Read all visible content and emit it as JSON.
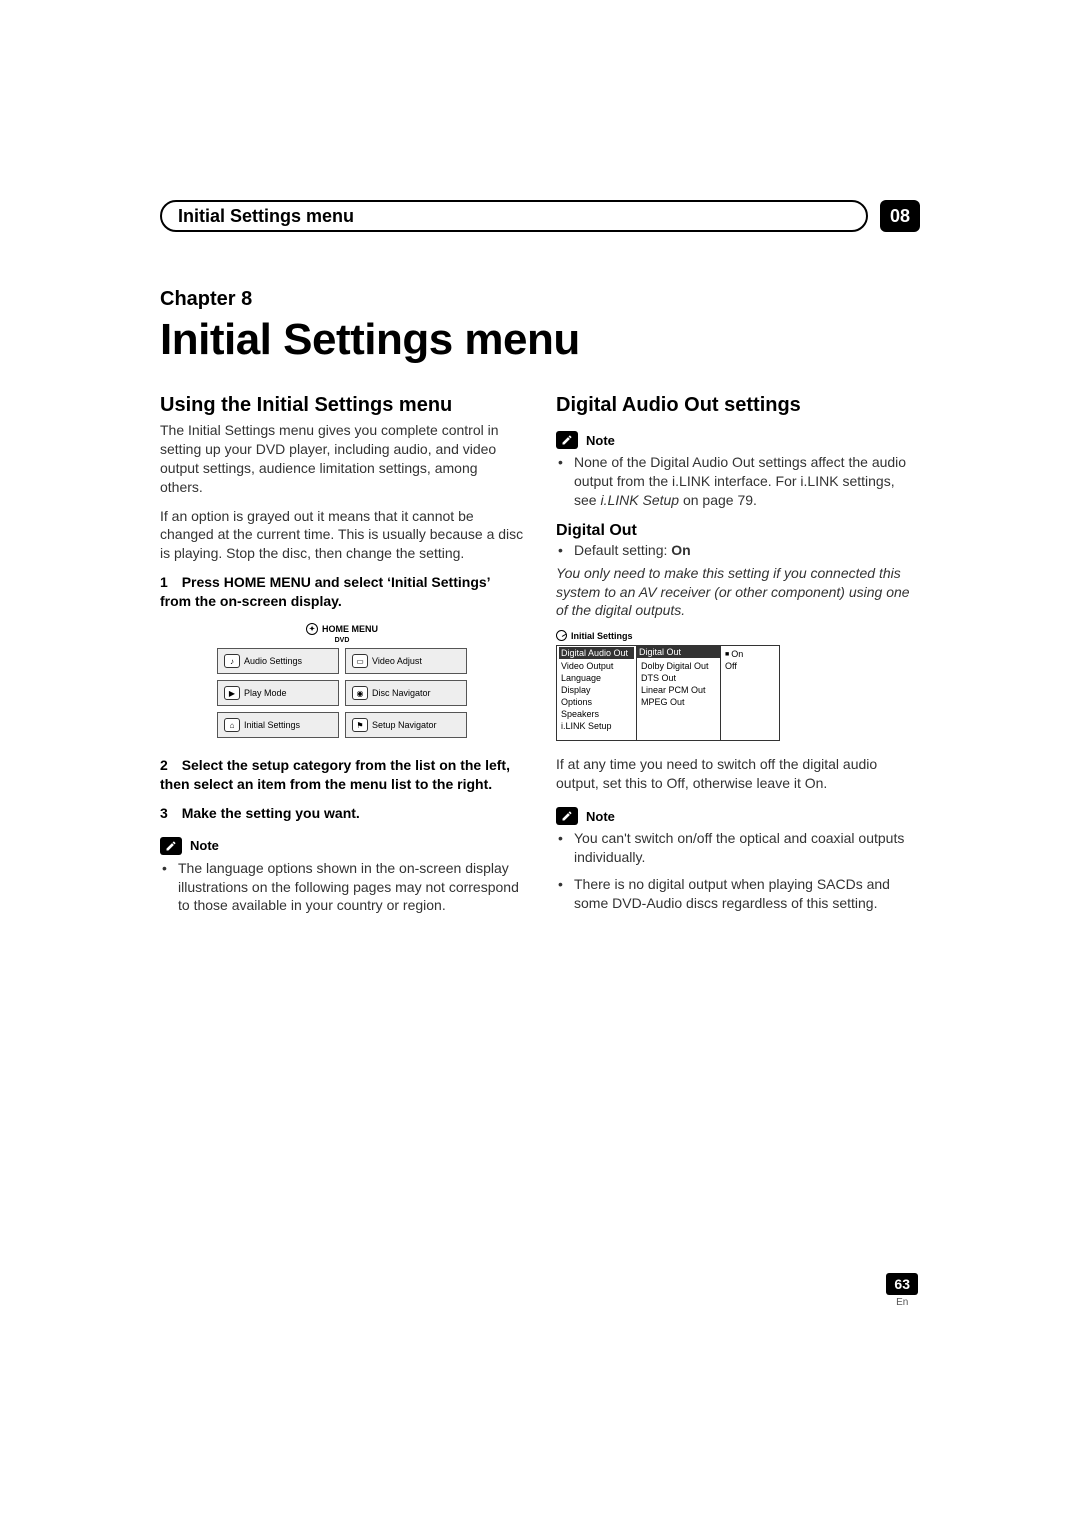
{
  "header": {
    "breadcrumb": "Initial Settings menu",
    "chapter_num": "08"
  },
  "chapter": {
    "label": "Chapter 8",
    "title": "Initial Settings menu"
  },
  "left": {
    "h2": "Using the Initial Settings menu",
    "p1": "The Initial Settings menu gives you complete control in setting up your DVD player, including audio, and video output settings, audience limitation settings, among others.",
    "p2": "If an option is grayed out it means that it cannot be changed at the current time. This is usually because a disc is playing. Stop the disc, then change the setting.",
    "step1_num": "1",
    "step1_txt": "Press HOME MENU and select ‘Initial Settings’ from the on-screen display.",
    "home_menu": {
      "title": "HOME MENU",
      "sub": "DVD",
      "cells": [
        "Audio Settings",
        "Video Adjust",
        "Play Mode",
        "Disc Navigator",
        "Initial Settings",
        "Setup Navigator"
      ]
    },
    "step2_num": "2",
    "step2_txt": "Select the setup category from the list on the left, then select an item from the menu list to the right.",
    "step3_num": "3",
    "step3_txt": "Make the setting you want.",
    "note_label": "Note",
    "note1": "The language options shown in the on-screen display illustrations on the following pages may not correspond to those available in your country or region."
  },
  "right": {
    "h2": "Digital Audio Out settings",
    "note_label": "Note",
    "note1_a": "None of the Digital Audio Out settings affect the audio output from the i.LINK interface. For i.LINK settings, see ",
    "note1_i": "i.LINK Setup",
    "note1_b": " on page 79.",
    "h3": "Digital Out",
    "default_label": "Default setting: ",
    "default_val": "On",
    "italic_p": "You only need to make this setting if you connected this system to an AV receiver (or other component) using one of the digital outputs.",
    "osd": {
      "title": "Initial Settings",
      "cats": [
        "Digital Audio Out",
        "Video Output",
        "Language",
        "Display",
        "Options",
        "Speakers",
        "i.LINK Setup"
      ],
      "items": [
        "Digital Out",
        "Dolby Digital Out",
        "DTS Out",
        "Linear PCM Out",
        "MPEG Out"
      ],
      "vals": [
        "On",
        "Off"
      ]
    },
    "p_after": "If at any time you need to switch off the digital audio output, set this to Off, otherwise leave it On.",
    "note2_label": "Note",
    "note2a": "You can't switch on/off the optical and coaxial outputs individually.",
    "note2b": "There is no digital output when playing SACDs and some DVD-Audio discs regardless of this setting."
  },
  "pagenum": {
    "num": "63",
    "lang": "En"
  }
}
